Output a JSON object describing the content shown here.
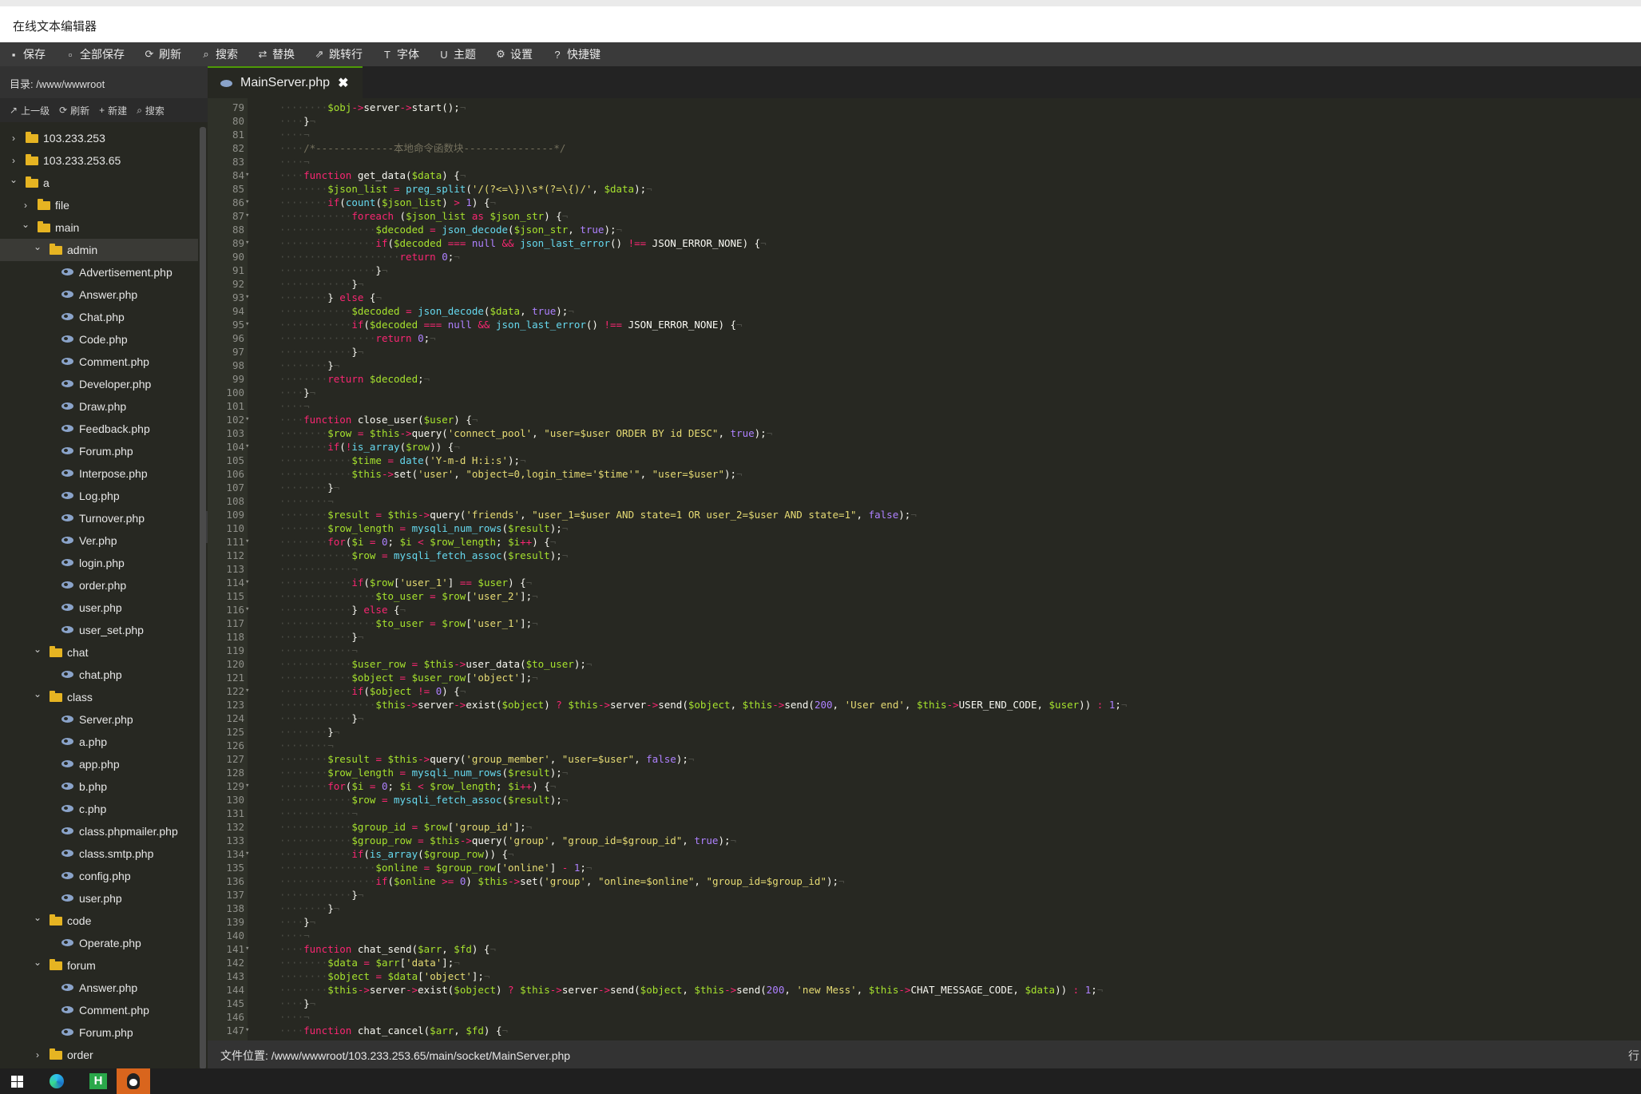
{
  "window": {
    "title": "在线文本编辑器"
  },
  "toolbar": [
    {
      "icon": "save-icon",
      "glyph": "▪",
      "label": "保存"
    },
    {
      "icon": "save-all-icon",
      "glyph": "▫",
      "label": "全部保存"
    },
    {
      "icon": "refresh-icon",
      "glyph": "⟳",
      "label": "刷新"
    },
    {
      "icon": "search-icon",
      "glyph": "⌕",
      "label": "搜索"
    },
    {
      "icon": "replace-icon",
      "glyph": "⇄",
      "label": "替换"
    },
    {
      "icon": "goto-line-icon",
      "glyph": "⇗",
      "label": "跳转行"
    },
    {
      "icon": "font-icon",
      "glyph": "T",
      "label": "字体"
    },
    {
      "icon": "theme-icon",
      "glyph": "U",
      "label": "主题"
    },
    {
      "icon": "settings-icon",
      "glyph": "⚙",
      "label": "设置"
    },
    {
      "icon": "shortcut-icon",
      "glyph": "?",
      "label": "快捷键"
    }
  ],
  "sidebar": {
    "dir_label": "目录: /www/wwwroot",
    "actions": [
      {
        "icon": "up-icon",
        "glyph": "↗",
        "label": "上一级"
      },
      {
        "icon": "refresh-icon",
        "glyph": "⟳",
        "label": "刷新"
      },
      {
        "icon": "plus-icon",
        "glyph": "+",
        "label": "新建"
      },
      {
        "icon": "search-icon",
        "glyph": "⌕",
        "label": "搜索"
      }
    ],
    "tree": [
      {
        "type": "folder",
        "depth": 0,
        "open": false,
        "label": "103.233.253"
      },
      {
        "type": "folder",
        "depth": 0,
        "open": false,
        "label": "103.233.253.65"
      },
      {
        "type": "folder",
        "depth": 0,
        "open": true,
        "label": "a"
      },
      {
        "type": "folder",
        "depth": 1,
        "open": false,
        "label": "file"
      },
      {
        "type": "folder",
        "depth": 1,
        "open": true,
        "label": "main"
      },
      {
        "type": "folder",
        "depth": 2,
        "open": true,
        "label": "admin",
        "selected": true
      },
      {
        "type": "file",
        "depth": 3,
        "label": "Advertisement.php"
      },
      {
        "type": "file",
        "depth": 3,
        "label": "Answer.php"
      },
      {
        "type": "file",
        "depth": 3,
        "label": "Chat.php"
      },
      {
        "type": "file",
        "depth": 3,
        "label": "Code.php"
      },
      {
        "type": "file",
        "depth": 3,
        "label": "Comment.php"
      },
      {
        "type": "file",
        "depth": 3,
        "label": "Developer.php"
      },
      {
        "type": "file",
        "depth": 3,
        "label": "Draw.php"
      },
      {
        "type": "file",
        "depth": 3,
        "label": "Feedback.php"
      },
      {
        "type": "file",
        "depth": 3,
        "label": "Forum.php"
      },
      {
        "type": "file",
        "depth": 3,
        "label": "Interpose.php"
      },
      {
        "type": "file",
        "depth": 3,
        "label": "Log.php"
      },
      {
        "type": "file",
        "depth": 3,
        "label": "Turnover.php"
      },
      {
        "type": "file",
        "depth": 3,
        "label": "Ver.php"
      },
      {
        "type": "file",
        "depth": 3,
        "label": "login.php"
      },
      {
        "type": "file",
        "depth": 3,
        "label": "order.php"
      },
      {
        "type": "file",
        "depth": 3,
        "label": "user.php"
      },
      {
        "type": "file",
        "depth": 3,
        "label": "user_set.php"
      },
      {
        "type": "folder",
        "depth": 2,
        "open": true,
        "label": "chat"
      },
      {
        "type": "file",
        "depth": 3,
        "label": "chat.php"
      },
      {
        "type": "folder",
        "depth": 2,
        "open": true,
        "label": "class"
      },
      {
        "type": "file",
        "depth": 3,
        "label": "Server.php"
      },
      {
        "type": "file",
        "depth": 3,
        "label": "a.php"
      },
      {
        "type": "file",
        "depth": 3,
        "label": "app.php"
      },
      {
        "type": "file",
        "depth": 3,
        "label": "b.php"
      },
      {
        "type": "file",
        "depth": 3,
        "label": "c.php"
      },
      {
        "type": "file",
        "depth": 3,
        "label": "class.phpmailer.php"
      },
      {
        "type": "file",
        "depth": 3,
        "label": "class.smtp.php"
      },
      {
        "type": "file",
        "depth": 3,
        "label": "config.php"
      },
      {
        "type": "file",
        "depth": 3,
        "label": "user.php"
      },
      {
        "type": "folder",
        "depth": 2,
        "open": true,
        "label": "code"
      },
      {
        "type": "file",
        "depth": 3,
        "label": "Operate.php"
      },
      {
        "type": "folder",
        "depth": 2,
        "open": true,
        "label": "forum"
      },
      {
        "type": "file",
        "depth": 3,
        "label": "Answer.php"
      },
      {
        "type": "file",
        "depth": 3,
        "label": "Comment.php"
      },
      {
        "type": "file",
        "depth": 3,
        "label": "Forum.php"
      },
      {
        "type": "folder",
        "depth": 2,
        "open": false,
        "label": "order"
      }
    ]
  },
  "tab": {
    "label": "MainServer.php",
    "close_glyph": "✖"
  },
  "editor": {
    "lines": [
      {
        "n": 79,
        "t": "        $obj->server->start();"
      },
      {
        "n": 80,
        "t": "    }"
      },
      {
        "n": 81,
        "t": "    "
      },
      {
        "n": 82,
        "t": "    /*-------------本地命令函数块---------------*/"
      },
      {
        "n": 83,
        "t": "    "
      },
      {
        "n": 84,
        "t": "    function get_data($data) {",
        "fold": true
      },
      {
        "n": 85,
        "t": "        $json_list = preg_split('/(?<=\\})\\s*(?=\\{)/', $data);"
      },
      {
        "n": 86,
        "t": "        if(count($json_list) > 1) {",
        "fold": true
      },
      {
        "n": 87,
        "t": "            foreach ($json_list as $json_str) {",
        "fold": true
      },
      {
        "n": 88,
        "t": "                $decoded = json_decode($json_str, true);"
      },
      {
        "n": 89,
        "t": "                if($decoded === null && json_last_error() !== JSON_ERROR_NONE) {",
        "fold": true
      },
      {
        "n": 90,
        "t": "                    return 0;"
      },
      {
        "n": 91,
        "t": "                }"
      },
      {
        "n": 92,
        "t": "            }"
      },
      {
        "n": 93,
        "t": "        } else {",
        "fold": true
      },
      {
        "n": 94,
        "t": "            $decoded = json_decode($data, true);"
      },
      {
        "n": 95,
        "t": "            if($decoded === null && json_last_error() !== JSON_ERROR_NONE) {",
        "fold": true
      },
      {
        "n": 96,
        "t": "                return 0;"
      },
      {
        "n": 97,
        "t": "            }"
      },
      {
        "n": 98,
        "t": "        }"
      },
      {
        "n": 99,
        "t": "        return $decoded;"
      },
      {
        "n": 100,
        "t": "    }"
      },
      {
        "n": 101,
        "t": "    "
      },
      {
        "n": 102,
        "t": "    function close_user($user) {",
        "fold": true
      },
      {
        "n": 103,
        "t": "        $row = $this->query('connect_pool', \"user=$user ORDER BY id DESC\", true);"
      },
      {
        "n": 104,
        "t": "        if(!is_array($row)) {",
        "fold": true
      },
      {
        "n": 105,
        "t": "            $time = date('Y-m-d H:i:s');"
      },
      {
        "n": 106,
        "t": "            $this->set('user', \"object=0,login_time='$time'\", \"user=$user\");"
      },
      {
        "n": 107,
        "t": "        }"
      },
      {
        "n": 108,
        "t": "        "
      },
      {
        "n": 109,
        "t": "        $result = $this->query('friends', \"user_1=$user AND state=1 OR user_2=$user AND state=1\", false);"
      },
      {
        "n": 110,
        "t": "        $row_length = mysqli_num_rows($result);"
      },
      {
        "n": 111,
        "t": "        for($i = 0; $i < $row_length; $i++) {",
        "fold": true
      },
      {
        "n": 112,
        "t": "            $row = mysqli_fetch_assoc($result);"
      },
      {
        "n": 113,
        "t": "            "
      },
      {
        "n": 114,
        "t": "            if($row['user_1'] == $user) {",
        "fold": true
      },
      {
        "n": 115,
        "t": "                $to_user = $row['user_2'];"
      },
      {
        "n": 116,
        "t": "            } else {",
        "fold": true
      },
      {
        "n": 117,
        "t": "                $to_user = $row['user_1'];"
      },
      {
        "n": 118,
        "t": "            }"
      },
      {
        "n": 119,
        "t": "            "
      },
      {
        "n": 120,
        "t": "            $user_row = $this->user_data($to_user);"
      },
      {
        "n": 121,
        "t": "            $object = $user_row['object'];"
      },
      {
        "n": 122,
        "t": "            if($object != 0) {",
        "fold": true
      },
      {
        "n": 123,
        "t": "                $this->server->exist($object) ? $this->server->send($object, $this->send(200, 'User end', $this->USER_END_CODE, $user)) : 1;"
      },
      {
        "n": 124,
        "t": "            }"
      },
      {
        "n": 125,
        "t": "        }"
      },
      {
        "n": 126,
        "t": "        "
      },
      {
        "n": 127,
        "t": "        $result = $this->query('group_member', \"user=$user\", false);"
      },
      {
        "n": 128,
        "t": "        $row_length = mysqli_num_rows($result);"
      },
      {
        "n": 129,
        "t": "        for($i = 0; $i < $row_length; $i++) {",
        "fold": true
      },
      {
        "n": 130,
        "t": "            $row = mysqli_fetch_assoc($result);"
      },
      {
        "n": 131,
        "t": "            "
      },
      {
        "n": 132,
        "t": "            $group_id = $row['group_id'];"
      },
      {
        "n": 133,
        "t": "            $group_row = $this->query('group', \"group_id=$group_id\", true);"
      },
      {
        "n": 134,
        "t": "            if(is_array($group_row)) {",
        "fold": true
      },
      {
        "n": 135,
        "t": "                $online = $group_row['online'] - 1;"
      },
      {
        "n": 136,
        "t": "                if($online >= 0) $this->set('group', \"online=$online\", \"group_id=$group_id\");"
      },
      {
        "n": 137,
        "t": "            }"
      },
      {
        "n": 138,
        "t": "        }"
      },
      {
        "n": 139,
        "t": "    }"
      },
      {
        "n": 140,
        "t": "    "
      },
      {
        "n": 141,
        "t": "    function chat_send($arr, $fd) {",
        "fold": true
      },
      {
        "n": 142,
        "t": "        $data = $arr['data'];"
      },
      {
        "n": 143,
        "t": "        $object = $data['object'];"
      },
      {
        "n": 144,
        "t": "        $this->server->exist($object) ? $this->server->send($object, $this->send(200, 'new Mess', $this->CHAT_MESSAGE_CODE, $data)) : 1;"
      },
      {
        "n": 145,
        "t": "    }"
      },
      {
        "n": 146,
        "t": "    "
      },
      {
        "n": 147,
        "t": "    function chat_cancel($arr, $fd) {",
        "fold": true
      }
    ]
  },
  "status": {
    "path": "文件位置: /www/wwwroot/103.233.253.65/main/socket/MainServer.php",
    "right": "行"
  }
}
